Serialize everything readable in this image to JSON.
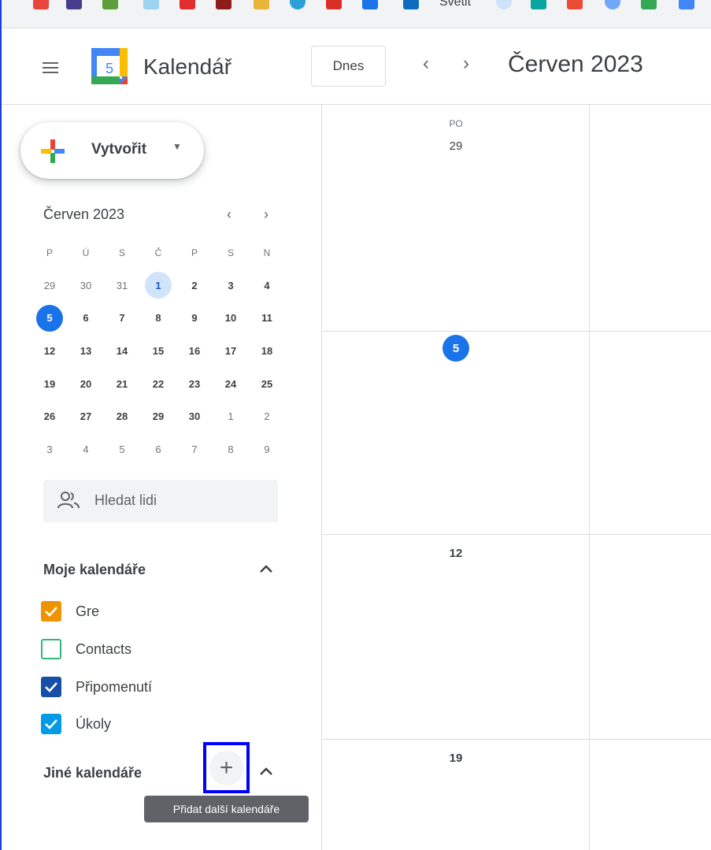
{
  "bookmarks": {
    "visible_label": "Svetit"
  },
  "header": {
    "app_title": "Kalendář",
    "logo_day": "5",
    "today_button": "Dnes",
    "prev_icon": "chevron-left-icon",
    "next_icon": "chevron-right-icon",
    "month_title": "Červen 2023"
  },
  "sidebar": {
    "create_label": "Vytvořit",
    "mini_calendar": {
      "title": "Červen 2023",
      "weekday_headers": [
        "P",
        "Ú",
        "S",
        "Č",
        "P",
        "S",
        "N"
      ],
      "weeks": [
        [
          "29",
          "30",
          "31",
          "1",
          "2",
          "3",
          "4"
        ],
        [
          "5",
          "6",
          "7",
          "8",
          "9",
          "10",
          "11"
        ],
        [
          "12",
          "13",
          "14",
          "15",
          "16",
          "17",
          "18"
        ],
        [
          "19",
          "20",
          "21",
          "22",
          "23",
          "24",
          "25"
        ],
        [
          "26",
          "27",
          "28",
          "29",
          "30",
          "1",
          "2"
        ],
        [
          "3",
          "4",
          "5",
          "6",
          "7",
          "8",
          "9"
        ]
      ]
    },
    "search_people_placeholder": "Hledat lidi",
    "my_calendars": {
      "title": "Moje kalendáře",
      "items": [
        {
          "label": "Gre",
          "color": "#f09300",
          "checked": true
        },
        {
          "label": "Contacts",
          "color": "#33b679",
          "checked": false
        },
        {
          "label": "Připomenutí",
          "color": "#174ea6",
          "checked": true
        },
        {
          "label": "Úkoly",
          "color": "#039be5",
          "checked": true
        }
      ]
    },
    "other_calendars": {
      "title": "Jiné kalendáře",
      "add_tooltip": "Přidat další kalendáře"
    }
  },
  "main": {
    "weekday": "PO",
    "rows": [
      {
        "day": "29"
      },
      {
        "day": "5"
      },
      {
        "day": "12"
      },
      {
        "day": "19"
      }
    ]
  },
  "colors": {
    "accent": "#1a73e8",
    "selected_day_bg": "#d2e3fc",
    "highlight_border": "#0000ff"
  }
}
